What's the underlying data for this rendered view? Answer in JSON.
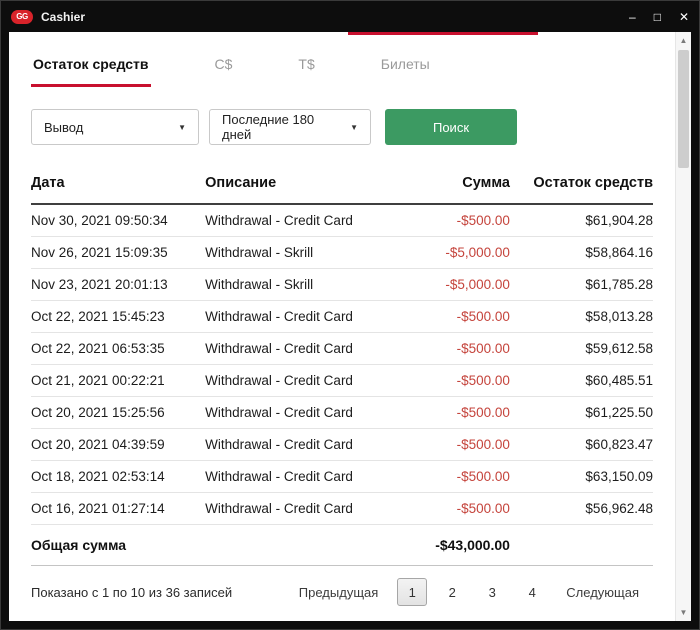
{
  "window": {
    "title": "Cashier"
  },
  "icons": {
    "logo": "GG",
    "minimize": "–",
    "maximize": "□",
    "close": "✕",
    "select_caret": "▼",
    "scroll_up": "▲",
    "scroll_down": "▼"
  },
  "tabs": {
    "items": [
      {
        "name": "tab-balance",
        "label": "Остаток средств",
        "active": true
      },
      {
        "name": "tab-c-dollar",
        "label": "C$",
        "active": false
      },
      {
        "name": "tab-t-dollar",
        "label": "T$",
        "active": false
      },
      {
        "name": "tab-tickets",
        "label": "Билеты",
        "active": false
      }
    ]
  },
  "filters": {
    "type_value": "Вывод",
    "period_value": "Последние 180 дней",
    "search_label": "Поиск"
  },
  "table": {
    "headers": [
      "Дата",
      "Описание",
      "Сумма",
      "Остаток средств"
    ],
    "rows": [
      {
        "date": "Nov 30, 2021 09:50:34",
        "description": "Withdrawal - Credit Card",
        "amount": "-$500.00",
        "balance": "$61,904.28"
      },
      {
        "date": "Nov 26, 2021 15:09:35",
        "description": "Withdrawal - Skrill",
        "amount": "-$5,000.00",
        "balance": "$58,864.16"
      },
      {
        "date": "Nov 23, 2021 20:01:13",
        "description": "Withdrawal - Skrill",
        "amount": "-$5,000.00",
        "balance": "$61,785.28"
      },
      {
        "date": "Oct 22, 2021 15:45:23",
        "description": "Withdrawal - Credit Card",
        "amount": "-$500.00",
        "balance": "$58,013.28"
      },
      {
        "date": "Oct 22, 2021 06:53:35",
        "description": "Withdrawal - Credit Card",
        "amount": "-$500.00",
        "balance": "$59,612.58"
      },
      {
        "date": "Oct 21, 2021 00:22:21",
        "description": "Withdrawal - Credit Card",
        "amount": "-$500.00",
        "balance": "$60,485.51"
      },
      {
        "date": "Oct 20, 2021 15:25:56",
        "description": "Withdrawal - Credit Card",
        "amount": "-$500.00",
        "balance": "$61,225.50"
      },
      {
        "date": "Oct 20, 2021 04:39:59",
        "description": "Withdrawal - Credit Card",
        "amount": "-$500.00",
        "balance": "$60,823.47"
      },
      {
        "date": "Oct 18, 2021 02:53:14",
        "description": "Withdrawal - Credit Card",
        "amount": "-$500.00",
        "balance": "$63,150.09"
      },
      {
        "date": "Oct 16, 2021 01:27:14",
        "description": "Withdrawal - Credit Card",
        "amount": "-$500.00",
        "balance": "$56,962.48"
      }
    ],
    "total_label": "Общая сумма",
    "total_amount": "-$43,000.00"
  },
  "pagination": {
    "info": "Показано с 1 по 10 из 36 записей",
    "prev_label": "Предыдущая",
    "pages": [
      "1",
      "2",
      "3",
      "4"
    ],
    "active_page": "1",
    "next_label": "Следующая"
  },
  "colors": {
    "accent_red": "#c8102e",
    "negative_red": "#c5443c",
    "button_green": "#3c9a62",
    "titlebar_bg": "#0d0d0d"
  }
}
